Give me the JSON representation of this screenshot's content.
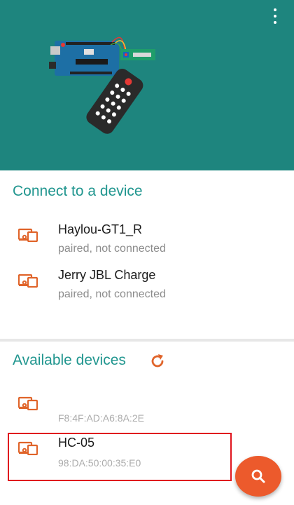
{
  "header": {
    "menu_icon": "more-vert-icon",
    "illustration": "arduino-bluetooth-remote-illustration",
    "background_color": "#1e857e"
  },
  "paired": {
    "title": "Connect to a device",
    "devices": [
      {
        "name": "Haylou-GT1_R",
        "status": "paired, not connected",
        "icon": "bluetooth-device-icon"
      },
      {
        "name": "Jerry JBL Charge",
        "status": "paired, not connected",
        "icon": "bluetooth-device-icon"
      }
    ]
  },
  "available": {
    "title": "Available devices",
    "refresh_icon": "refresh-icon",
    "devices": [
      {
        "name": "",
        "address": "F8:4F:AD:A6:8A:2E",
        "icon": "bluetooth-device-icon"
      },
      {
        "name": "HC-05",
        "address": "98:DA:50:00:35:E0",
        "icon": "bluetooth-device-icon",
        "highlighted": true
      }
    ]
  },
  "fab": {
    "icon": "search-icon",
    "color": "#ec5a2c"
  },
  "colors": {
    "accent": "#21968f",
    "icon_orange": "#e0642a",
    "highlight_border": "#e0141e"
  }
}
